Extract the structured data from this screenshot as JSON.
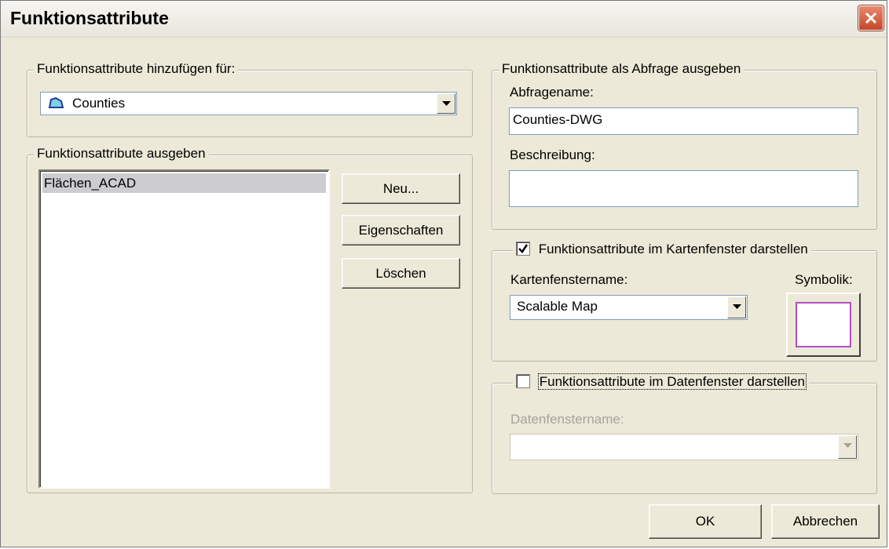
{
  "window": {
    "title": "Funktionsattribute"
  },
  "add_group": {
    "legend": "Funktionsattribute hinzufügen für:",
    "layer_value": "Counties",
    "layer_icon": "polygon-layer-icon"
  },
  "output_group": {
    "legend": "Funktionsattribute ausgeben",
    "items": [
      "Flächen_ACAD"
    ],
    "buttons": {
      "new": "Neu...",
      "properties": "Eigenschaften",
      "delete": "Löschen"
    }
  },
  "query_group": {
    "legend": "Funktionsattribute als Abfrage ausgeben",
    "name_label": "Abfragename:",
    "name_value": "Counties-DWG",
    "desc_label": "Beschreibung:",
    "desc_value": ""
  },
  "map_group": {
    "checkbox_label": "Funktionsattribute im Kartenfenster darstellen",
    "checked": true,
    "name_label": "Kartenfenstername:",
    "name_value": "Scalable Map",
    "symbol_label": "Symbolik:",
    "symbol_color": "#b04fc0"
  },
  "data_group": {
    "checkbox_label": "Funktionsattribute im Datenfenster darstellen",
    "checked": false,
    "name_label": "Datenfenstername:",
    "name_value": ""
  },
  "footer": {
    "ok": "OK",
    "cancel": "Abbrechen"
  }
}
